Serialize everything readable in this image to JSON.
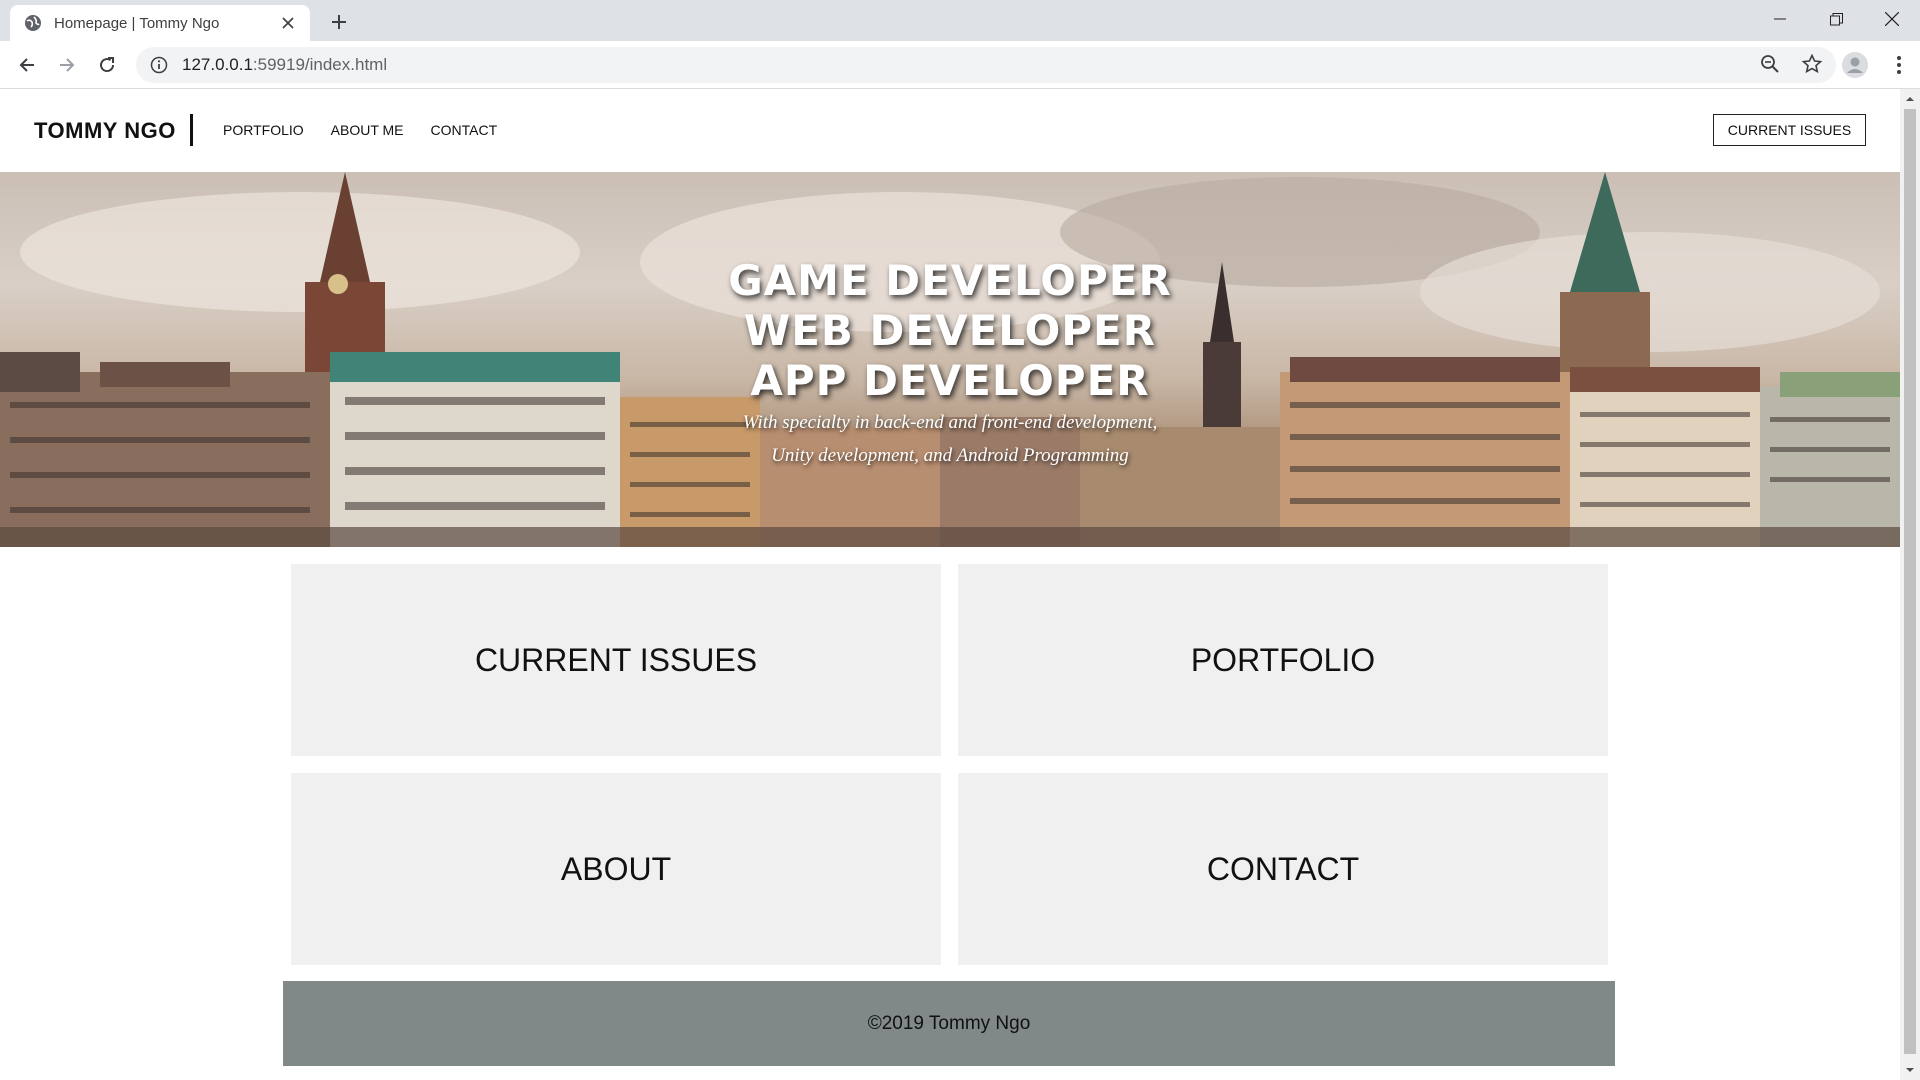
{
  "browser": {
    "tab_title": "Homepage | Tommy Ngo",
    "url_host": "127.0.0.1",
    "url_rest": ":59919/index.html"
  },
  "site": {
    "brand": "TOMMY NGO",
    "nav": [
      {
        "label": "PORTFOLIO"
      },
      {
        "label": "ABOUT ME"
      },
      {
        "label": "CONTACT"
      }
    ],
    "cta_label": "CURRENT ISSUES"
  },
  "hero": {
    "lines": [
      "GAME DEVELOPER",
      "WEB DEVELOPER",
      "APP DEVELOPER"
    ],
    "subtitle_lines": [
      "With specialty in back-end and front-end development,",
      "Unity development, and Android Programming"
    ]
  },
  "tiles": [
    {
      "label": "CURRENT ISSUES"
    },
    {
      "label": "PORTFOLIO"
    },
    {
      "label": "ABOUT"
    },
    {
      "label": "CONTACT"
    }
  ],
  "footer": {
    "text": "©2019 Tommy Ngo",
    "background": "#818888"
  },
  "colors": {
    "tile_background": "#f0f0f0",
    "chrome_tabbar": "#dee1e6"
  },
  "icons": [
    "globe-icon",
    "close-icon",
    "plus-icon",
    "minimize-icon",
    "restore-icon",
    "back-icon",
    "forward-icon",
    "reload-icon",
    "info-icon",
    "zoom-icon",
    "star-icon",
    "profile-icon",
    "menu-icon"
  ]
}
